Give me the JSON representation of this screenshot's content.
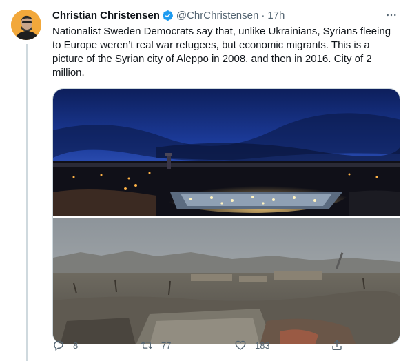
{
  "tweet": {
    "author_name": "Christian Christensen",
    "handle": "@ChrChristensen",
    "separator": "·",
    "time": "17h",
    "text": "Nationalist Sweden Democrats say that, unlike Ukrainians, Syrians fleeing to Europe weren’t real war refugees, but economic migrants. This is a picture of the Syrian city of Aleppo in 2008, and then in 2016. City of 2 million."
  },
  "actions": {
    "reply_count": "8",
    "retweet_count": "77",
    "like_count": "183"
  },
  "icons": {
    "verified": "verified-badge-icon",
    "more": "more-options-icon",
    "reply": "reply-icon",
    "retweet": "retweet-icon",
    "like": "heart-icon",
    "share": "share-icon"
  },
  "colors": {
    "verified": "#1d9bf0",
    "text_secondary": "#536471",
    "avatar_bg": "#f2a83b"
  }
}
